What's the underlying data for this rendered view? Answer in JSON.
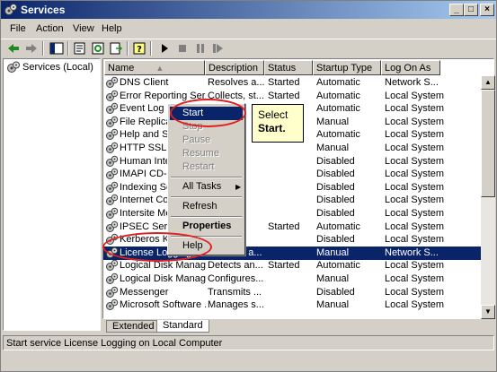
{
  "window": {
    "title": "Services"
  },
  "title_buttons": {
    "minimize": "_",
    "maximize": "□",
    "close": "×"
  },
  "menu": [
    "File",
    "Action",
    "View",
    "Help"
  ],
  "tree": {
    "root": "Services (Local)"
  },
  "columns": [
    "Name",
    "Description",
    "Status",
    "Startup Type",
    "Log On As"
  ],
  "services": [
    {
      "name": "DNS Client",
      "desc": "Resolves a...",
      "status": "Started",
      "startup": "Automatic",
      "logon": "Network S..."
    },
    {
      "name": "Error Reporting Ser...",
      "desc": "Collects, st...",
      "status": "Started",
      "startup": "Automatic",
      "logon": "Local System"
    },
    {
      "name": "Event Log",
      "desc": "",
      "status": "",
      "startup": "Automatic",
      "logon": "Local System"
    },
    {
      "name": "File Replicati",
      "desc": "",
      "status": "",
      "startup": "Manual",
      "logon": "Local System"
    },
    {
      "name": "Help and Sup",
      "desc": "",
      "status": "",
      "startup": "Automatic",
      "logon": "Local System"
    },
    {
      "name": "HTTP SSL",
      "desc": "",
      "status": "",
      "startup": "Manual",
      "logon": "Local System"
    },
    {
      "name": "Human Interf",
      "desc": "",
      "status": "",
      "startup": "Disabled",
      "logon": "Local System"
    },
    {
      "name": "IMAPI CD-Bu",
      "desc": "",
      "status": "",
      "startup": "Disabled",
      "logon": "Local System"
    },
    {
      "name": "Indexing Serv",
      "desc": "",
      "status": "",
      "startup": "Disabled",
      "logon": "Local System"
    },
    {
      "name": "Internet Con",
      "desc": "",
      "status": "",
      "startup": "Disabled",
      "logon": "Local System"
    },
    {
      "name": "Intersite Mes",
      "desc": "",
      "status": "",
      "startup": "Disabled",
      "logon": "Local System"
    },
    {
      "name": "IPSEC Servic",
      "desc": "",
      "status": "Started",
      "startup": "Automatic",
      "logon": "Local System"
    },
    {
      "name": "Kerberos Key",
      "desc": "...",
      "status": "",
      "startup": "Disabled",
      "logon": "Local System"
    },
    {
      "name": "License Logging",
      "desc": "Monitors a...",
      "status": "",
      "startup": "Manual",
      "logon": "Network S..."
    },
    {
      "name": "Logical Disk Manager",
      "desc": "Detects an...",
      "status": "Started",
      "startup": "Automatic",
      "logon": "Local System"
    },
    {
      "name": "Logical Disk Manage...",
      "desc": "Configures...",
      "status": "",
      "startup": "Manual",
      "logon": "Local System"
    },
    {
      "name": "Messenger",
      "desc": "Transmits ...",
      "status": "",
      "startup": "Disabled",
      "logon": "Local System"
    },
    {
      "name": "Microsoft Software ...",
      "desc": "Manages s...",
      "status": "",
      "startup": "Manual",
      "logon": "Local System"
    }
  ],
  "context_menu": {
    "start": "Start",
    "stop": "Stop",
    "pause": "Pause",
    "resume": "Resume",
    "restart": "Restart",
    "all_tasks": "All Tasks",
    "refresh": "Refresh",
    "properties": "Properties",
    "help": "Help"
  },
  "callout": {
    "line1": "Select",
    "line2": "Start."
  },
  "tabs": [
    "Extended",
    "Standard"
  ],
  "status": "Start service License Logging on Local Computer",
  "colors": {
    "selection": "#0a246a",
    "callout_bg": "#ffffcc",
    "highlight_ring": "#e02020"
  }
}
